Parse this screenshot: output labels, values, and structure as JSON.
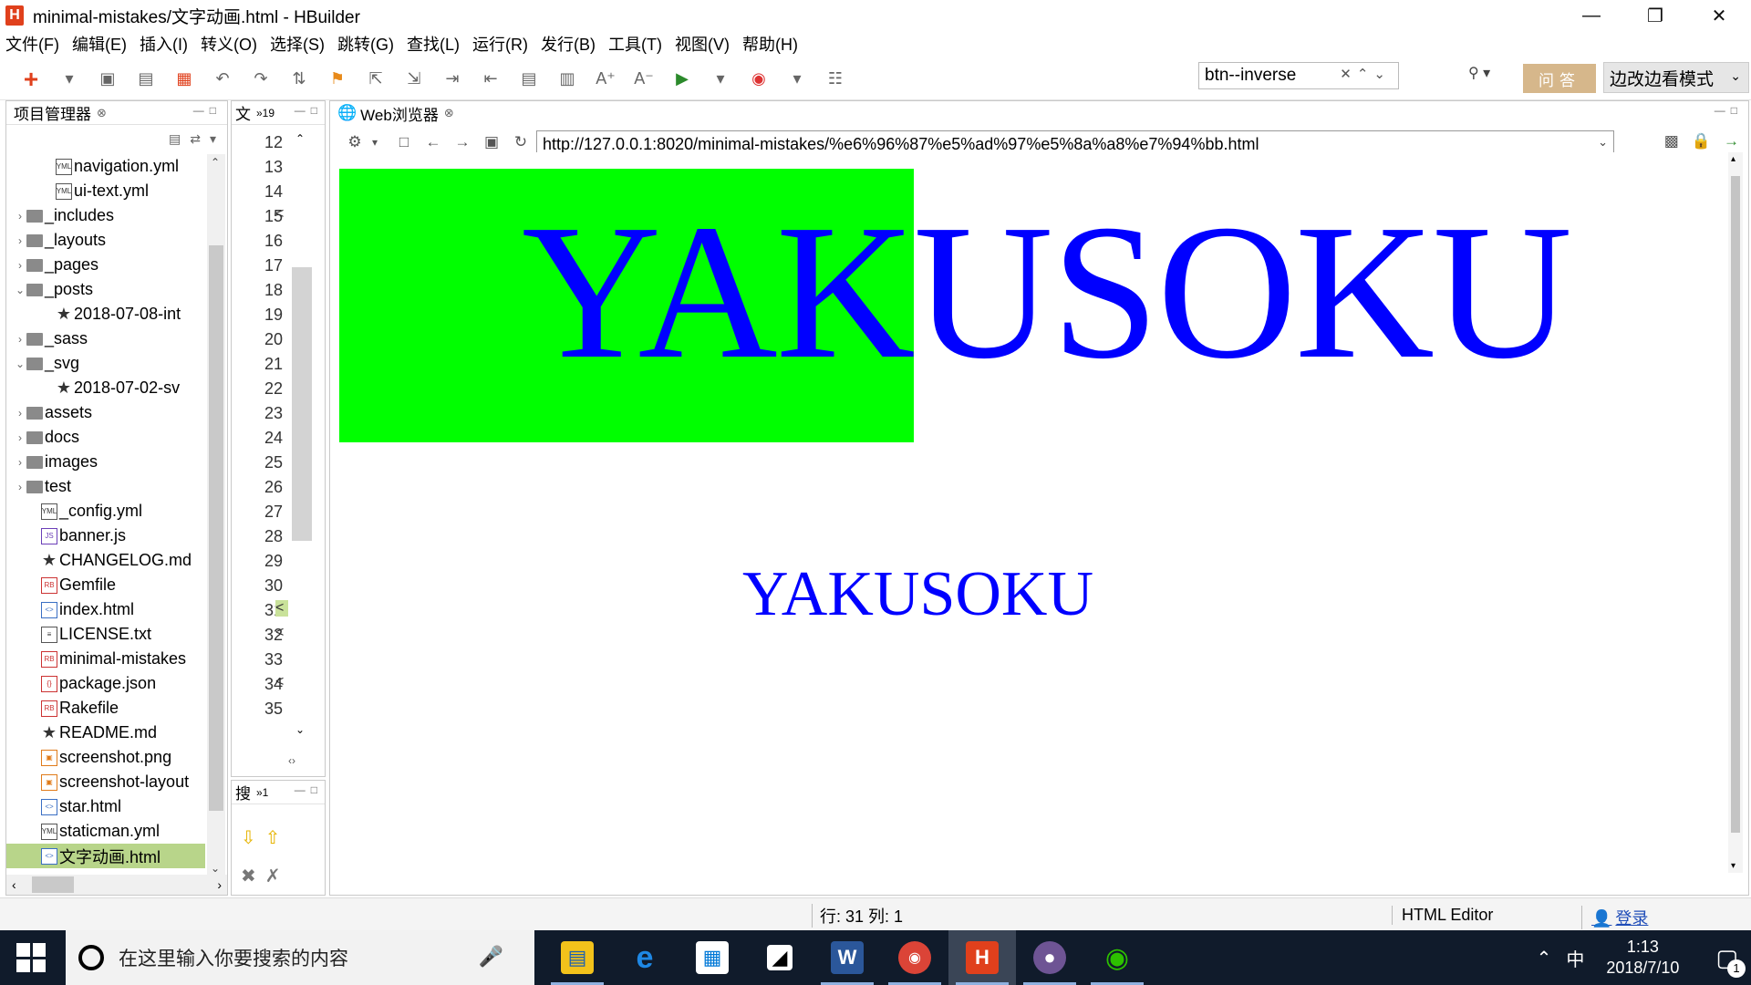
{
  "window": {
    "title": "minimal-mistakes/文字动画.html  -  HBuilder",
    "app_icon": "H"
  },
  "menu": [
    "文件(F)",
    "编辑(E)",
    "插入(I)",
    "转义(O)",
    "选择(S)",
    "跳转(G)",
    "查找(L)",
    "运行(R)",
    "发行(B)",
    "工具(T)",
    "视图(V)",
    "帮助(H)"
  ],
  "toolbar": {
    "search_value": "btn--inverse",
    "qa_label": "问答",
    "mode_label": "边改边看模式"
  },
  "project_panel": {
    "title": "项目管理器",
    "items": [
      {
        "label": "navigation.yml",
        "icon": "yml-file-icon",
        "indent": 3,
        "arrow": ""
      },
      {
        "label": "ui-text.yml",
        "icon": "yml-file-icon",
        "indent": 3,
        "arrow": ""
      },
      {
        "label": "_includes",
        "icon": "folder-icon",
        "indent": 1,
        "arrow": "›"
      },
      {
        "label": "_layouts",
        "icon": "folder-icon",
        "indent": 1,
        "arrow": "›"
      },
      {
        "label": "_pages",
        "icon": "folder-icon",
        "indent": 1,
        "arrow": "›"
      },
      {
        "label": "_posts",
        "icon": "folder-icon",
        "indent": 1,
        "arrow": "⌄"
      },
      {
        "label": "2018-07-08-int",
        "icon": "star-icon",
        "indent": 3,
        "arrow": ""
      },
      {
        "label": "_sass",
        "icon": "folder-icon",
        "indent": 1,
        "arrow": "›"
      },
      {
        "label": "_svg",
        "icon": "folder-icon",
        "indent": 1,
        "arrow": "⌄"
      },
      {
        "label": "2018-07-02-sv",
        "icon": "star-icon",
        "indent": 3,
        "arrow": ""
      },
      {
        "label": "assets",
        "icon": "folder-icon",
        "indent": 1,
        "arrow": "›"
      },
      {
        "label": "docs",
        "icon": "folder-icon",
        "indent": 1,
        "arrow": "›"
      },
      {
        "label": "images",
        "icon": "folder-icon",
        "indent": 1,
        "arrow": "›"
      },
      {
        "label": "test",
        "icon": "folder-icon",
        "indent": 1,
        "arrow": "›"
      },
      {
        "label": "_config.yml",
        "icon": "yml-file-icon",
        "indent": 2,
        "arrow": ""
      },
      {
        "label": "banner.js",
        "icon": "js-file-icon",
        "indent": 2,
        "arrow": ""
      },
      {
        "label": "CHANGELOG.md",
        "icon": "star-icon",
        "indent": 2,
        "arrow": ""
      },
      {
        "label": "Gemfile",
        "icon": "ruby-file-icon",
        "indent": 2,
        "arrow": ""
      },
      {
        "label": "index.html",
        "icon": "html-file-icon",
        "indent": 2,
        "arrow": ""
      },
      {
        "label": "LICENSE.txt",
        "icon": "text-file-icon",
        "indent": 2,
        "arrow": ""
      },
      {
        "label": "minimal-mistakes",
        "icon": "ruby-file-icon",
        "indent": 2,
        "arrow": ""
      },
      {
        "label": "package.json",
        "icon": "json-file-icon",
        "indent": 2,
        "arrow": ""
      },
      {
        "label": "Rakefile",
        "icon": "ruby-file-icon",
        "indent": 2,
        "arrow": ""
      },
      {
        "label": "README.md",
        "icon": "star-icon",
        "indent": 2,
        "arrow": ""
      },
      {
        "label": "screenshot.png",
        "icon": "image-file-icon",
        "indent": 2,
        "arrow": ""
      },
      {
        "label": "screenshot-layout",
        "icon": "image-file-icon",
        "indent": 2,
        "arrow": ""
      },
      {
        "label": "star.html",
        "icon": "html-file-icon",
        "indent": 2,
        "arrow": ""
      },
      {
        "label": "staticman.yml",
        "icon": "yml-file-icon",
        "indent": 2,
        "arrow": ""
      },
      {
        "label": "文字动画.html",
        "icon": "html-file-icon",
        "indent": 2,
        "arrow": "",
        "selected": true
      }
    ]
  },
  "code_panel": {
    "tab_label": "文",
    "tab_extra": "»19",
    "line_numbers": [
      "12",
      "13",
      "14",
      "15",
      "16",
      "17",
      "18",
      "19",
      "20",
      "21",
      "22",
      "23",
      "24",
      "25",
      "26",
      "27",
      "28",
      "29",
      "30",
      "31",
      "32",
      "33",
      "34",
      "35"
    ],
    "fold_lines": [
      "16",
      "23",
      "24"
    ],
    "code_fragments": [
      {
        "line": "15",
        "text": "<",
        "highlight": false
      },
      {
        "line": "31",
        "text": "<",
        "highlight": true
      },
      {
        "line": "32",
        "text": "<",
        "highlight": false
      },
      {
        "line": "34",
        "text": "<",
        "highlight": false
      }
    ]
  },
  "search_panel": {
    "tab_label": "搜",
    "tab_extra": "»1"
  },
  "browser": {
    "tab_label": "Web浏览器",
    "url": "http://127.0.0.1:8020/minimal-mistakes/%e6%96%87%e5%ad%97%e5%8a%a8%e7%94%bb.html",
    "animated_text": "YAKUSOKU",
    "static_text": "YAKUSOKU",
    "fill_progress": 0.42,
    "colors": {
      "fill": "#00ff00",
      "text": "#0000ff"
    }
  },
  "status": {
    "position": "行: 31 列: 1",
    "editor": "HTML Editor",
    "login": "登录"
  },
  "taskbar": {
    "search_placeholder": "在这里输入你要搜索的内容",
    "apps": [
      "file-explorer-icon",
      "edge-icon",
      "store-icon",
      "sticky-notes-icon",
      "word-icon",
      "chrome-icon",
      "hbuilder-icon",
      "github-icon",
      "wechat-icon"
    ],
    "ime": "中",
    "time": "1:13",
    "date": "2018/7/10",
    "notifications": "1"
  }
}
